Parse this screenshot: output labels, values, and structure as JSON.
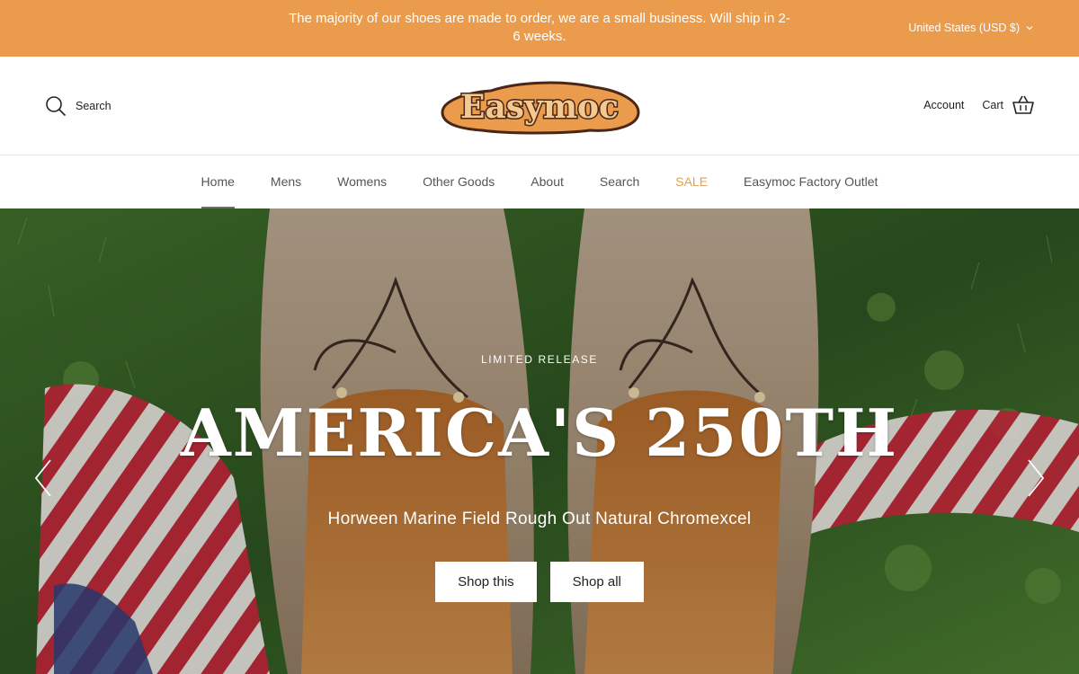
{
  "announcement": {
    "text": "The majority of our shoes are made to order, we are a small business. Will ship in 2-6 weeks."
  },
  "currency": {
    "label": "United States (USD $)",
    "icon": "chevron-down-icon"
  },
  "header": {
    "search_label": "Search",
    "logo_text": "Easymoc",
    "account_label": "Account",
    "cart_label": "Cart"
  },
  "nav": {
    "items": [
      {
        "label": "Home"
      },
      {
        "label": "Mens"
      },
      {
        "label": "Womens"
      },
      {
        "label": "Other Goods"
      },
      {
        "label": "About"
      },
      {
        "label": "Search"
      },
      {
        "label": "SALE"
      },
      {
        "label": "Easymoc Factory Outlet"
      }
    ]
  },
  "hero": {
    "eyebrow": "LIMITED RELEASE",
    "title": "AMERICA'S 250TH",
    "subtitle": "Horween Marine Field Rough Out Natural Chromexcel",
    "primary_button": "Shop this",
    "secondary_button": "Shop all"
  },
  "colors": {
    "announcement_bg": "#ea9c4c",
    "sale_nav": "#e3a150",
    "logo_fill": "#f3c991",
    "logo_outline": "#4a2616"
  }
}
